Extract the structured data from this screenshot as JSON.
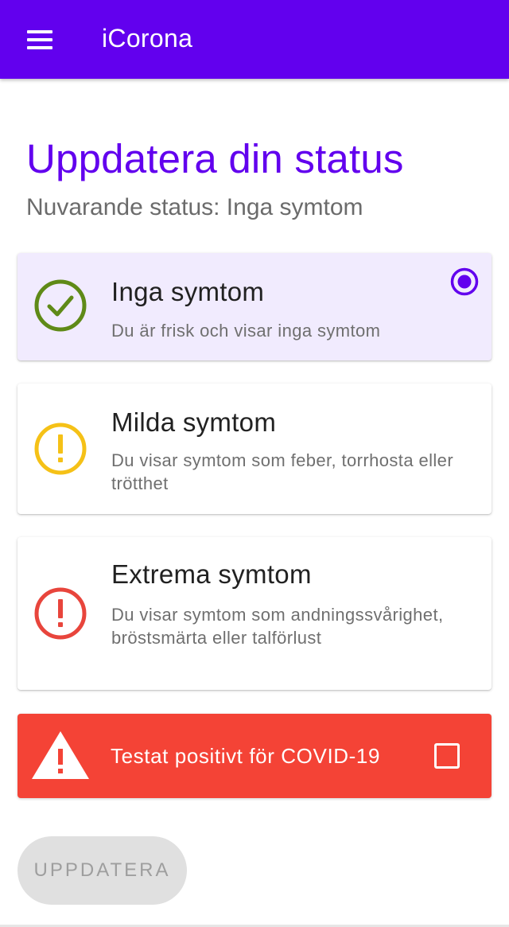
{
  "appbar": {
    "title": "iCorona",
    "menu_icon": "hamburger-menu-icon",
    "background": "#6200ee"
  },
  "page": {
    "title": "Uppdatera din status",
    "current_status": "Nuvarande status: Inga symtom"
  },
  "options": [
    {
      "title": "Inga symtom",
      "description": "Du är frisk och visar inga symtom",
      "icon": "check-circle-icon",
      "icon_color": "#5f8a17",
      "selected": true
    },
    {
      "title": "Milda symtom",
      "description": "Du visar symtom som feber, torrhosta eller trötthet",
      "icon": "exclamation-circle-icon",
      "icon_color": "#f5c117",
      "selected": false
    },
    {
      "title": "Extrema symtom",
      "description": "Du visar symtom som andningssvårighet, bröstsmärta eller talförlust",
      "icon": "exclamation-circle-icon",
      "icon_color": "#e8453c",
      "selected": false
    }
  ],
  "positive_test": {
    "label": "Testat positivt för COVID-19",
    "icon": "warning-triangle-icon",
    "checked": false,
    "background": "#f44336"
  },
  "update_button": {
    "label": "UPPDATERA",
    "enabled": false
  },
  "accent_color": "#6200ee"
}
